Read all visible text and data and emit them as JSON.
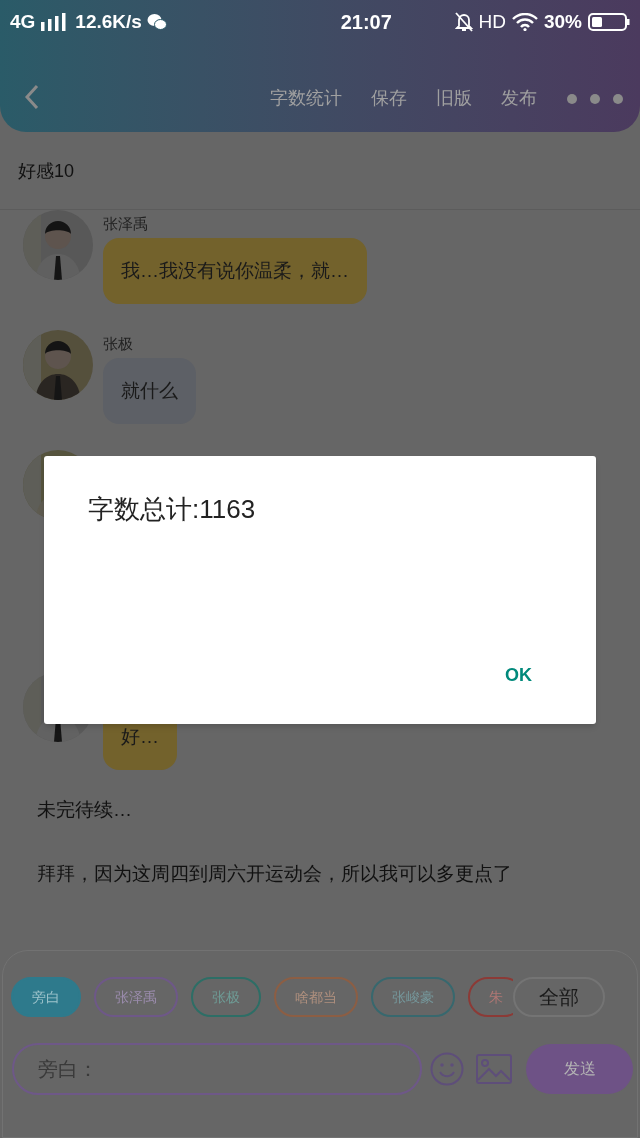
{
  "status_bar": {
    "network": "4G",
    "speed": "12.6K/s",
    "time": "21:07",
    "hd": "HD",
    "battery": "30%"
  },
  "header": {
    "actions": [
      "字数统计",
      "保存",
      "旧版",
      "发布"
    ]
  },
  "subtitle": "好感10",
  "messages": [
    {
      "kind": "chat",
      "name": "张泽禹",
      "text": "我…我没有说你温柔，就…",
      "color": "#73622c"
    },
    {
      "kind": "chat",
      "name": "张极",
      "text": "就什么",
      "color": "#5d6066"
    },
    {
      "kind": "chat"
    },
    {
      "kind": "chat",
      "text": "好…",
      "color": "#73622c"
    },
    {
      "kind": "narration",
      "text": "未完待续…"
    },
    {
      "kind": "narration",
      "text": "拜拜，因为这周四到周六开运动会，所以我可以多更点了"
    }
  ],
  "roles": [
    {
      "label": "旁白",
      "selected": true,
      "color": "#2e7a8c"
    },
    {
      "label": "张泽禹",
      "selected": false,
      "color": "#6e5888"
    },
    {
      "label": "张极",
      "selected": false,
      "color": "#2d6e66"
    },
    {
      "label": "啥都当",
      "selected": false,
      "color": "#8c5e44"
    },
    {
      "label": "张峻豪",
      "selected": false,
      "color": "#37686e"
    },
    {
      "label": "朱",
      "selected": false,
      "color": "#8c3a36"
    }
  ],
  "all_button": "全部",
  "input": {
    "placeholder": "旁白："
  },
  "send": "发送",
  "dialog": {
    "message": "字数总计:1163",
    "ok": "OK"
  }
}
